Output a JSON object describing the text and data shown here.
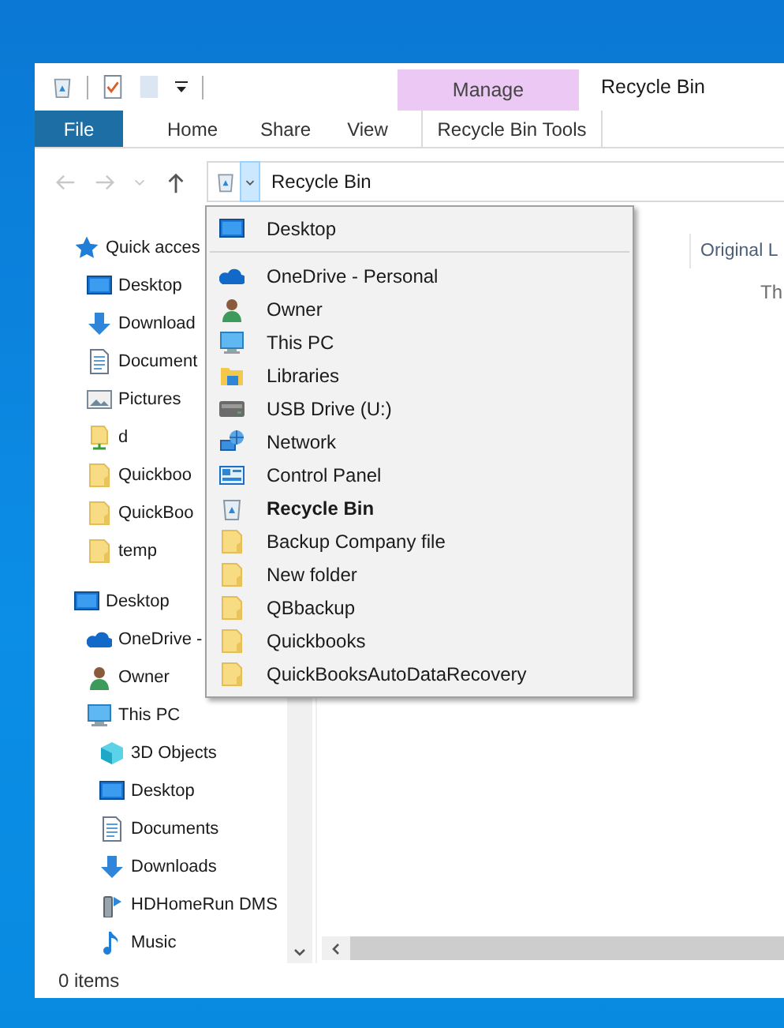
{
  "ribbon": {
    "context_group": "Manage",
    "title": "Recycle Bin",
    "tabs": [
      {
        "label": "File",
        "kind": "file"
      },
      {
        "label": "Home",
        "kind": "normal"
      },
      {
        "label": "Share",
        "kind": "normal"
      },
      {
        "label": "View",
        "kind": "normal"
      },
      {
        "label": "Recycle Bin Tools",
        "kind": "contextual"
      }
    ]
  },
  "address_bar": {
    "location": "Recycle Bin",
    "dropdown_open": true
  },
  "location_menu": [
    {
      "label": "Desktop",
      "kind": "desktop",
      "current": false
    },
    {
      "label": "OneDrive - Personal",
      "kind": "onedrive",
      "current": false
    },
    {
      "label": "Owner",
      "kind": "user",
      "current": false
    },
    {
      "label": "This PC",
      "kind": "pc",
      "current": false
    },
    {
      "label": "Libraries",
      "kind": "libraries",
      "current": false
    },
    {
      "label": "USB Drive (U:)",
      "kind": "drive",
      "current": false
    },
    {
      "label": "Network",
      "kind": "network",
      "current": false
    },
    {
      "label": "Control Panel",
      "kind": "control-panel",
      "current": false
    },
    {
      "label": "Recycle Bin",
      "kind": "recycle",
      "current": true
    },
    {
      "label": "Backup Company file",
      "kind": "folder",
      "current": false
    },
    {
      "label": "New folder",
      "kind": "folder",
      "current": false
    },
    {
      "label": "QBbackup",
      "kind": "folder",
      "current": false
    },
    {
      "label": "Quickbooks",
      "kind": "folder",
      "current": false
    },
    {
      "label": "QuickBooksAutoDataRecovery",
      "kind": "folder",
      "current": false
    }
  ],
  "navigation_pane": {
    "items": [
      {
        "label": "Quick acces",
        "kind": "star",
        "children": [
          {
            "label": "Desktop",
            "kind": "desktop"
          },
          {
            "label": "Download",
            "kind": "download"
          },
          {
            "label": "Document",
            "kind": "document"
          },
          {
            "label": "Pictures",
            "kind": "pictures"
          },
          {
            "label": "d",
            "kind": "shared-folder"
          },
          {
            "label": "Quickboo",
            "kind": "folder"
          },
          {
            "label": "QuickBoo",
            "kind": "folder"
          },
          {
            "label": "temp",
            "kind": "folder"
          }
        ]
      },
      {
        "label": "Desktop",
        "kind": "desktop",
        "children": [
          {
            "label": "OneDrive -",
            "kind": "onedrive"
          },
          {
            "label": "Owner",
            "kind": "user"
          },
          {
            "label": "This PC",
            "kind": "pc",
            "children": [
              {
                "label": "3D Objects",
                "kind": "cube"
              },
              {
                "label": "Desktop",
                "kind": "desktop"
              },
              {
                "label": "Documents",
                "kind": "document"
              },
              {
                "label": "Downloads",
                "kind": "download"
              },
              {
                "label": "HDHomeRun DMS",
                "kind": "media"
              },
              {
                "label": "Music",
                "kind": "music"
              }
            ]
          }
        ]
      }
    ]
  },
  "content": {
    "column_header": "Original L",
    "empty_message": "Th"
  },
  "status_bar": {
    "item_count": "0 items"
  }
}
